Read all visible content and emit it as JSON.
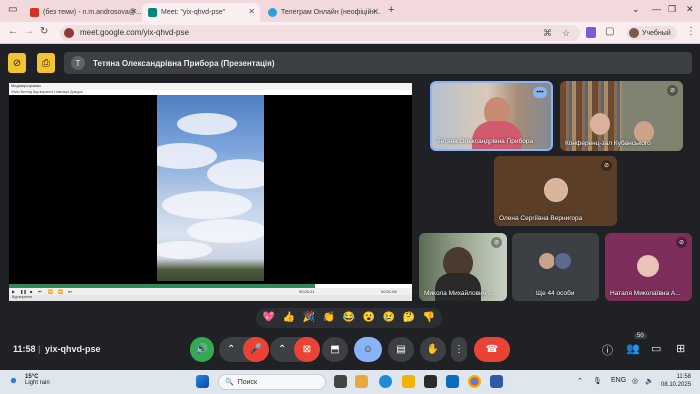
{
  "browser": {
    "tabs": [
      {
        "title": "(без теми) - n.m.androsova@...",
        "active": false,
        "favicon_color": "#d93025"
      },
      {
        "title": "Meet: \"yix-qhvd-pse\"",
        "active": true,
        "favicon_color": "#00897b"
      },
      {
        "title": "Телеграм Онлайн (неофіційн...",
        "active": false,
        "favicon_color": "#2aa1da"
      }
    ],
    "new_tab_label": "+",
    "url": "meet.google.com/yix-qhvd-pse",
    "profile_label": "Учебный"
  },
  "meet": {
    "presenter": {
      "initial": "T",
      "label": "Тетяна Олександрівна Прибора (Презентація)"
    },
    "presentation": {
      "window_title": "Медіапрогравач",
      "menu": "Файл  Вигляд  Відтворення  Навігація  Довідка",
      "time_left": "00:00:21",
      "time_right": "00:01:08",
      "status": "Відтворення",
      "progress": 0.76
    },
    "tiles": [
      {
        "name": "Тетяна Олександрівна Прибора",
        "active": true
      },
      {
        "name": "Конференц-зал Кубанського",
        "active": false
      },
      {
        "name": "Олена Сергіївна Вернигора",
        "active": false
      },
      {
        "name": "Микола Михайлович ...",
        "active": false
      },
      {
        "name": "Ще 44 особи",
        "active": false
      },
      {
        "name": "Наталя Миколаївна А...",
        "active": false
      }
    ],
    "reactions": [
      "💖",
      "👍",
      "🎉",
      "👏",
      "😂",
      "😮",
      "😢",
      "🤔",
      "👎"
    ],
    "bottom": {
      "time": "11:58",
      "separator": "|",
      "code": "yix-qhvd-pse",
      "participants_count": "50"
    },
    "accent_colors": {
      "mic_off": "#ea4335",
      "speaker": "#34a853",
      "emoji": "#8ab4f8",
      "leave": "#ea4335"
    }
  },
  "taskbar": {
    "weather_temp": "15°C",
    "weather_desc": "Light rain",
    "search_placeholder": "Поиск",
    "language": "ENG",
    "time": "11:58",
    "date": "08.10.2025"
  }
}
